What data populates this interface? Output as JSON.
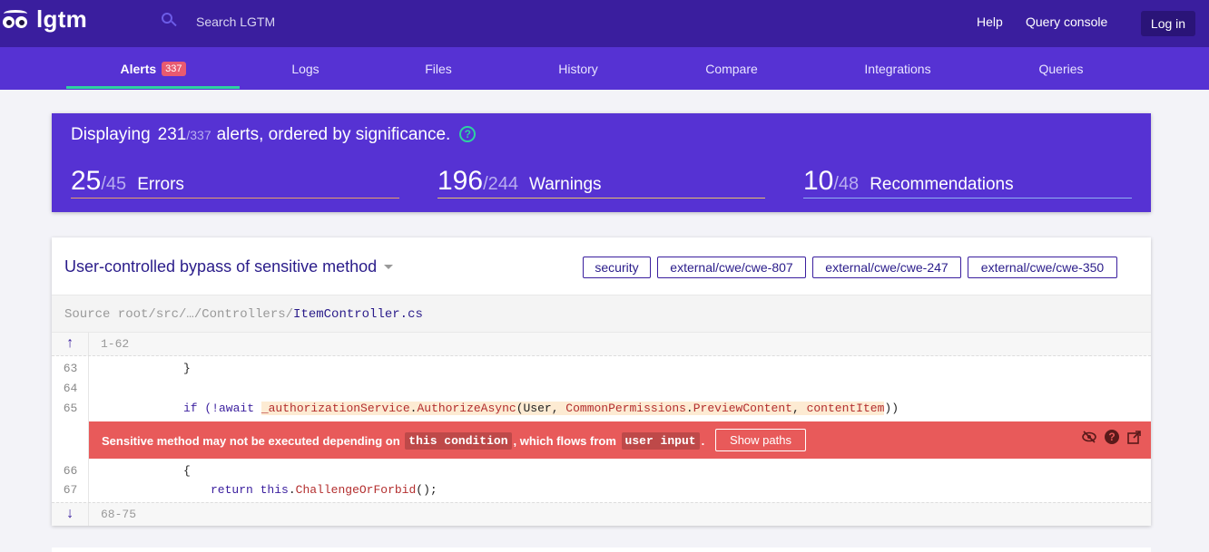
{
  "header": {
    "logo_text": "lgtm",
    "search_placeholder": "Search LGTM",
    "links": [
      "Help",
      "Query console"
    ],
    "login_label": "Log in"
  },
  "tabs": [
    {
      "label": "Alerts",
      "badge": "337",
      "active": true
    },
    {
      "label": "Logs"
    },
    {
      "label": "Files"
    },
    {
      "label": "History"
    },
    {
      "label": "Compare"
    },
    {
      "label": "Integrations"
    },
    {
      "label": "Queries"
    }
  ],
  "summary": {
    "prefix": "Displaying",
    "shown": "231",
    "total": "/337",
    "suffix": "alerts, ordered by significance.",
    "help_icon": "?",
    "stats": [
      {
        "count": "25",
        "total": "/45",
        "label": "Errors",
        "color": "#e8a06a"
      },
      {
        "count": "196",
        "total": "/244",
        "label": "Warnings",
        "color": "#e8c06a"
      },
      {
        "count": "10",
        "total": "/48",
        "label": "Recommendations",
        "color": "#8fb0f0"
      }
    ]
  },
  "alert": {
    "title": "User-controlled bypass of sensitive method",
    "tags": [
      "security",
      "external/cwe/cwe-807",
      "external/cwe/cwe-247",
      "external/cwe/cwe-350"
    ],
    "source_prefix": "Source root/src/…/Controllers/",
    "source_file": "ItemController.cs",
    "fold_top": {
      "arrow": "↑",
      "range": "1-62"
    },
    "fold_bottom": {
      "arrow": "↓",
      "range": "68-75"
    },
    "lines": {
      "l63": {
        "num": "63",
        "text": "}"
      },
      "l64": {
        "num": "64",
        "text": ""
      },
      "l65": {
        "num": "65"
      },
      "l66": {
        "num": "66",
        "text": "{"
      },
      "l67": {
        "num": "67"
      }
    },
    "code65": {
      "a": "if (!await ",
      "b": "_authorizationService",
      "c": ".",
      "d": "AuthorizeAsync",
      "e": "(User, ",
      "f": "CommonPermissions",
      "g": ".",
      "h": "PreviewContent",
      "i": ", ",
      "j": "contentItem",
      "k": "))"
    },
    "code67": {
      "kw": "return",
      "this": "this",
      "dot": ".",
      "method": "ChallengeOrForbid",
      "end": "();"
    },
    "message": {
      "part1": "Sensitive method may not be executed depending on",
      "code1": "this condition",
      "part2": ", which flows from",
      "code2": "user input",
      "part3": ".",
      "button": "Show paths"
    }
  },
  "colors": {
    "topbar": "#3a1e9e",
    "navbar": "#5632d3",
    "accent": "#2ed2a0",
    "alert_red": "#e85a5a"
  }
}
